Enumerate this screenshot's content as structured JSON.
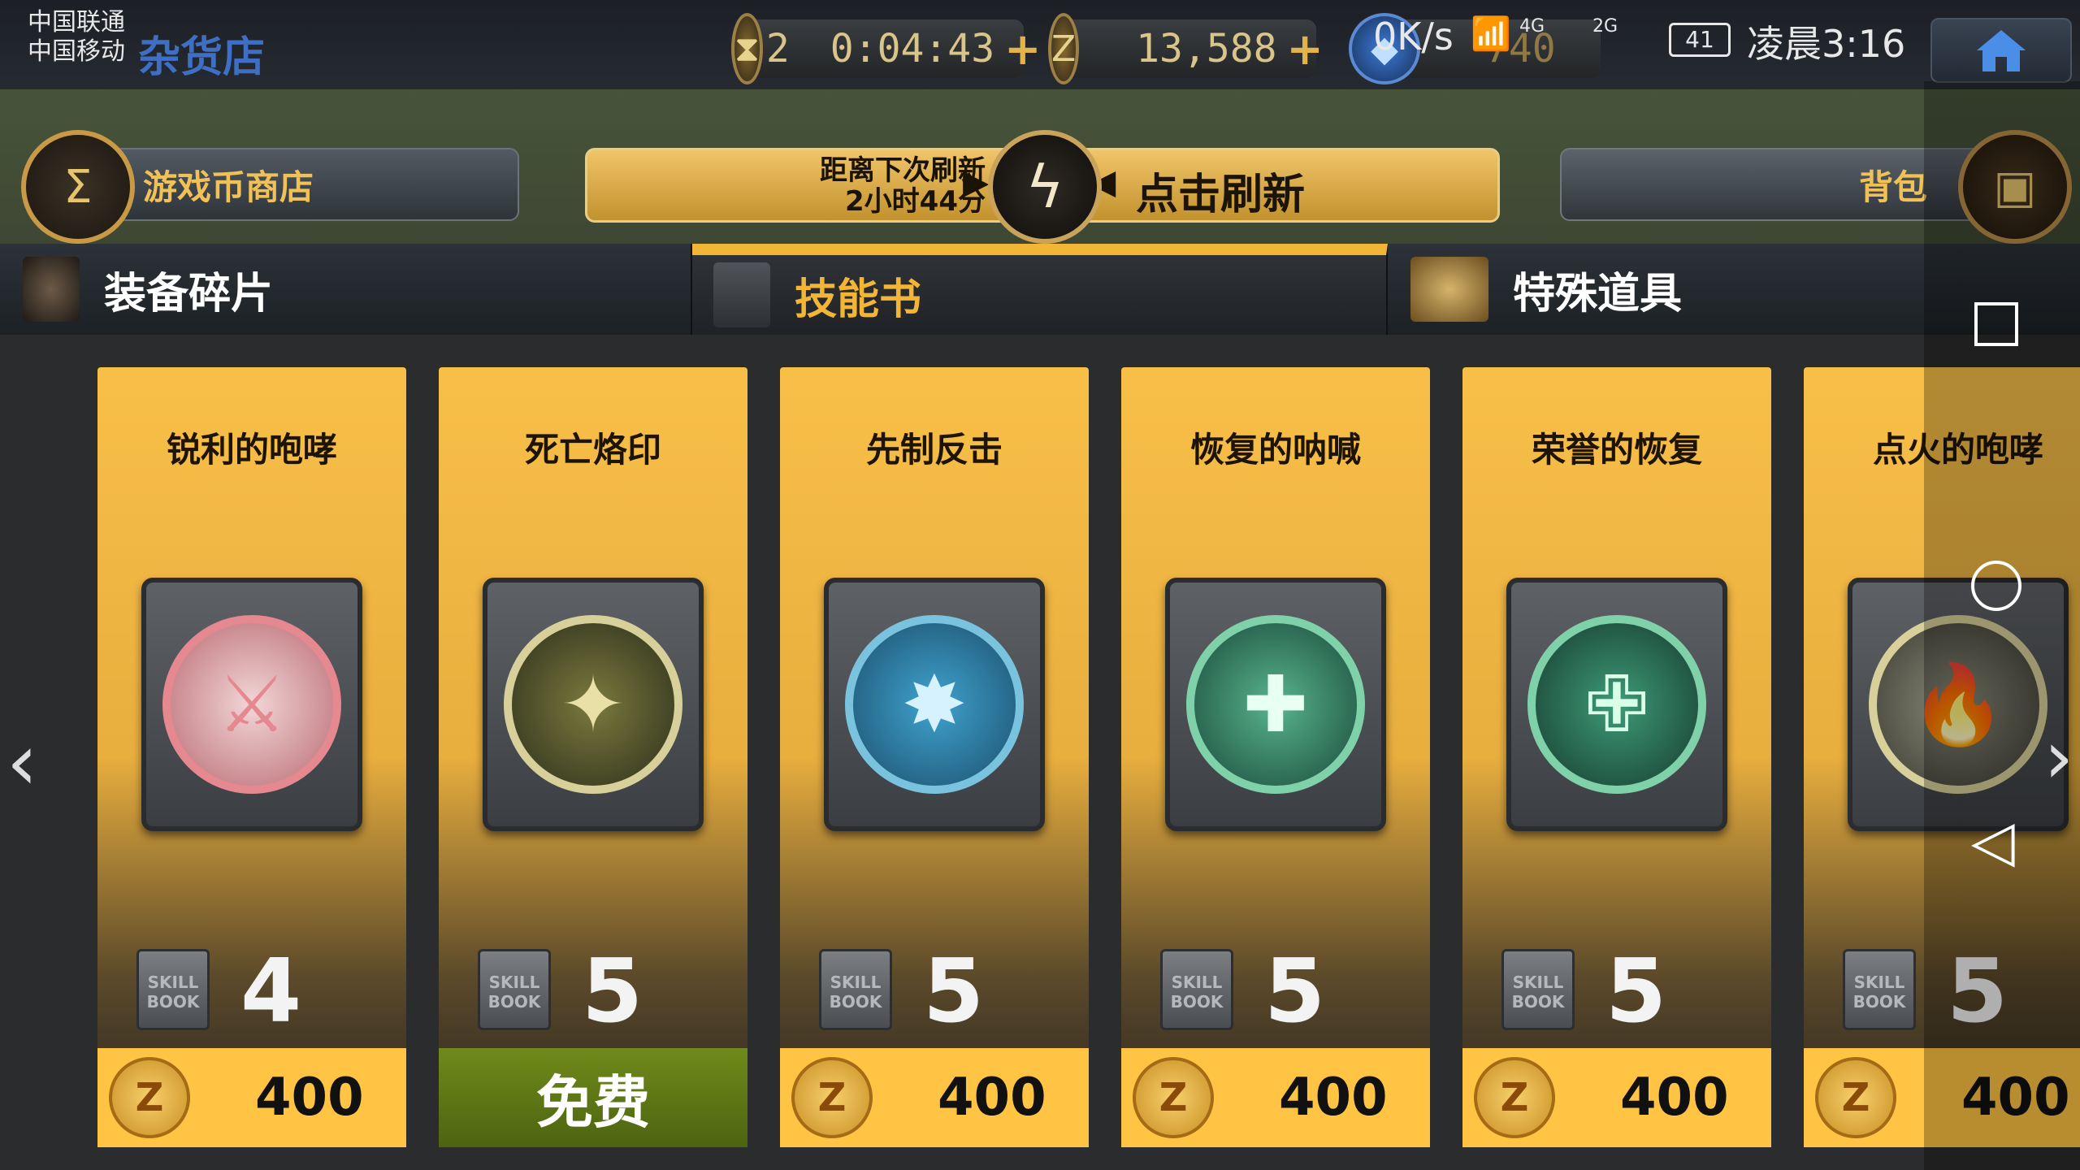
{
  "status_bar": {
    "carrier1": "中国联通",
    "carrier2": "中国移动",
    "network_speed": "0K/s",
    "signal_4g": "4G",
    "signal_2g": "2G",
    "battery": "41",
    "time": "凌晨3:16"
  },
  "top_bar": {
    "shop_title": "杂货店",
    "energy_count": "2",
    "timer": "0:04:43",
    "coins": "13,588",
    "gems": "740"
  },
  "header": {
    "coin_shop_label": "游戏币商店",
    "refresh_countdown_line1": "距离下次刷新",
    "refresh_countdown_line2": "2小时44分",
    "refresh_button_label": "点击刷新",
    "bag_label": "背包"
  },
  "tabs": [
    {
      "label": "装备碎片",
      "active": false
    },
    {
      "label": "技能书",
      "active": true
    },
    {
      "label": "特殊道具",
      "active": false
    }
  ],
  "items": [
    {
      "name": "锐利的咆哮",
      "qty": "4",
      "price": "400",
      "icon": "sword-person-icon",
      "color": "#e5888f"
    },
    {
      "name": "死亡烙印",
      "qty": "5",
      "price": "免费",
      "free": true,
      "icon": "winged-star-icon",
      "color": "#d8d09a"
    },
    {
      "name": "先制反击",
      "qty": "5",
      "price": "400",
      "icon": "shield-burst-icon",
      "color": "#79c3df"
    },
    {
      "name": "恢复的呐喊",
      "qty": "5",
      "price": "400",
      "icon": "person-heal-icon",
      "color": "#7fd1a9"
    },
    {
      "name": "荣誉的恢复",
      "qty": "5",
      "price": "400",
      "icon": "winged-cross-icon",
      "color": "#7fd1a9"
    },
    {
      "name": "点火的咆哮",
      "qty": "5",
      "price": "400",
      "icon": "fire-icon",
      "color": "#d8d09a"
    }
  ],
  "skill_book_label": "SKILL BOOK"
}
